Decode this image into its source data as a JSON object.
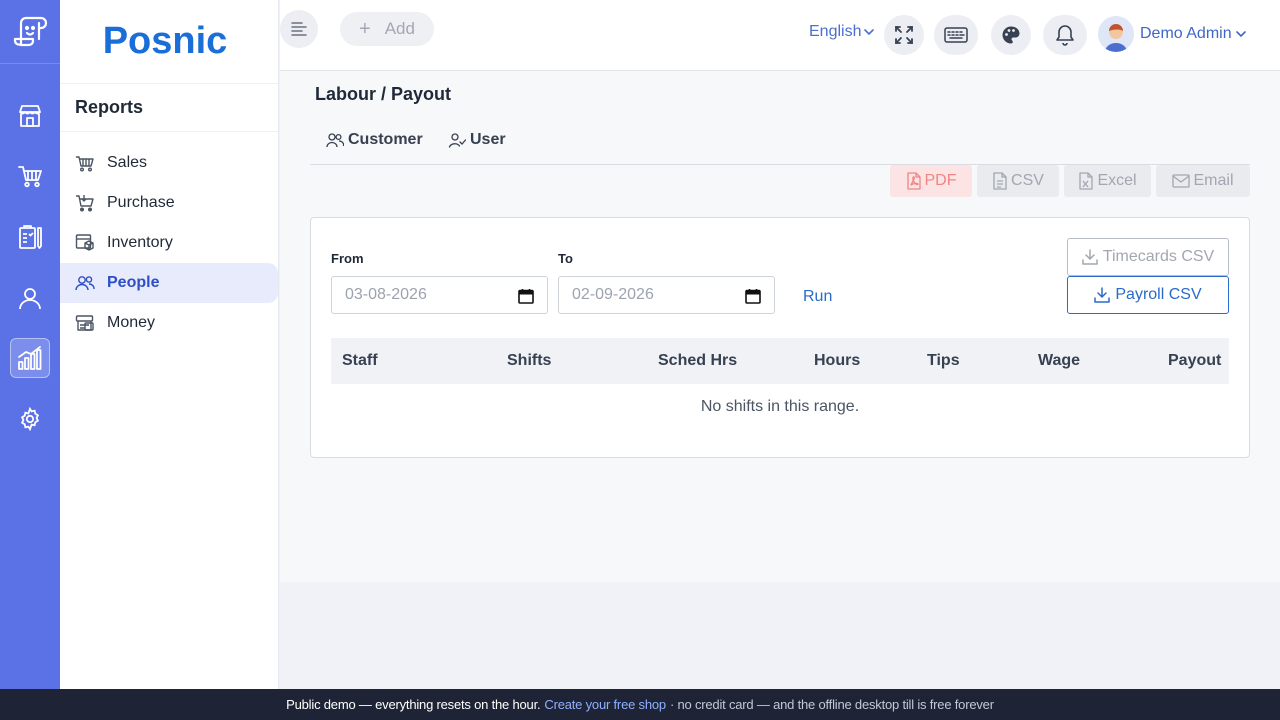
{
  "app": {
    "brand": "Posnic"
  },
  "rail": {
    "items": [
      {
        "icon": "store-icon"
      },
      {
        "icon": "cart-icon"
      },
      {
        "icon": "clipboard-icon"
      },
      {
        "icon": "user-icon"
      },
      {
        "icon": "reports-chart-icon",
        "active": true
      },
      {
        "icon": "gear-icon"
      }
    ]
  },
  "sidebar": {
    "title": "Reports",
    "items": [
      {
        "label": "Sales",
        "icon": "basket-icon"
      },
      {
        "label": "Purchase",
        "icon": "cart-icon"
      },
      {
        "label": "Inventory",
        "icon": "box-icon"
      },
      {
        "label": "People",
        "icon": "people-icon",
        "active": true
      },
      {
        "label": "Money",
        "icon": "money-icon"
      }
    ]
  },
  "topbar": {
    "add_label": "Add",
    "language": "English",
    "user_name": "Demo Admin"
  },
  "page": {
    "breadcrumb": "Labour / Payout",
    "tabs": [
      {
        "label": "Customer"
      },
      {
        "label": "User"
      }
    ],
    "exports": {
      "pdf": "PDF",
      "csv": "CSV",
      "excel": "Excel",
      "email": "Email"
    },
    "filters": {
      "from_label": "From",
      "from_value": "03-08-2026",
      "to_label": "To",
      "to_value": "02-09-2026",
      "run_label": "Run"
    },
    "buttons": {
      "timecards": "Timecards CSV",
      "payroll": "Payroll CSV"
    },
    "table": {
      "columns": [
        "Staff",
        "Shifts",
        "Sched Hrs",
        "Hours",
        "Tips",
        "Wage",
        "Payout"
      ],
      "empty_message": "No shifts in this range."
    }
  },
  "notice": {
    "text": "Public demo — everything resets on the hour.",
    "link": "Create your free shop",
    "tail": "· no credit card — and the offline desktop till is free forever"
  },
  "colors": {
    "accent": "#5a72e6",
    "link": "#2a6ac9",
    "brand": "#1a6ed8",
    "pdf": "#f08585"
  }
}
